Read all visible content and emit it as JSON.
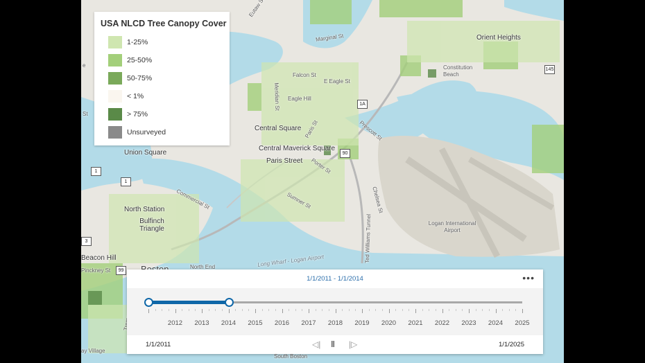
{
  "legend": {
    "title": "USA NLCD Tree Canopy Cover",
    "items": [
      {
        "label": "1-25%",
        "color": "#cfe6b0"
      },
      {
        "label": "25-50%",
        "color": "#a3cf7a"
      },
      {
        "label": "50-75%",
        "color": "#7aa95a"
      },
      {
        "label": "< 1%",
        "color": "#faf6ef"
      },
      {
        "label": "> 75%",
        "color": "#5a8a48"
      },
      {
        "label": "Unsurveyed",
        "color": "#8a8a8a"
      }
    ]
  },
  "map": {
    "labels": {
      "eutaw": "Eutaw St",
      "orient_heights": "Orient Heights",
      "marginal": "Marginal St",
      "falcon": "Falcon St",
      "e_eagle": "E Eagle St",
      "meridian": "Meridian St",
      "eagle_hill": "Eagle Hill",
      "central_square": "Central Square",
      "central_maverick": "Central Maverick Square",
      "paris_street": "Paris Street",
      "paris_st": "Paris St",
      "porter": "Porter St",
      "prescott": "Prescott St",
      "sumner": "Sumner St",
      "union_square": "Union Square",
      "north_station": "North Station",
      "bulfinch": "Bulfinch Triangle",
      "commercial": "Commercial St",
      "beacon_hill": "Beacon Hill",
      "pinckney": "Pinckney St",
      "north_end": "North End",
      "boston": "Boston",
      "bay_village": "ay Village",
      "south_boston": "South Boston",
      "long_wharf": "Long Wharf - Logan Airport",
      "ted_williams": "Ted Williams Tunnel",
      "logan": "Logan International Airport",
      "constitution_beach": "Constitution Beach",
      "tremont": "Tremont",
      "chelsea": "Chelsea St",
      "st_left": "St",
      "e_left": "e"
    },
    "shields": {
      "i1a": "1A",
      "i90": "90",
      "us1a": "1",
      "us1b": "1",
      "r145": "145",
      "r3": "3",
      "r99": "99"
    }
  },
  "time_slider": {
    "range_label": "1/1/2011 - 1/1/2014",
    "start_label": "1/1/2011",
    "end_label": "1/1/2025",
    "years": [
      "2012",
      "2013",
      "2014",
      "2015",
      "2016",
      "2017",
      "2018",
      "2019",
      "2020",
      "2021",
      "2022",
      "2023",
      "2024",
      "2025"
    ],
    "min_year": 2011,
    "max_year": 2025,
    "range_start_year": 2011,
    "range_end_year": 2014,
    "more_icon": "more-horizontal-icon",
    "accent_color": "#0f67a8"
  }
}
